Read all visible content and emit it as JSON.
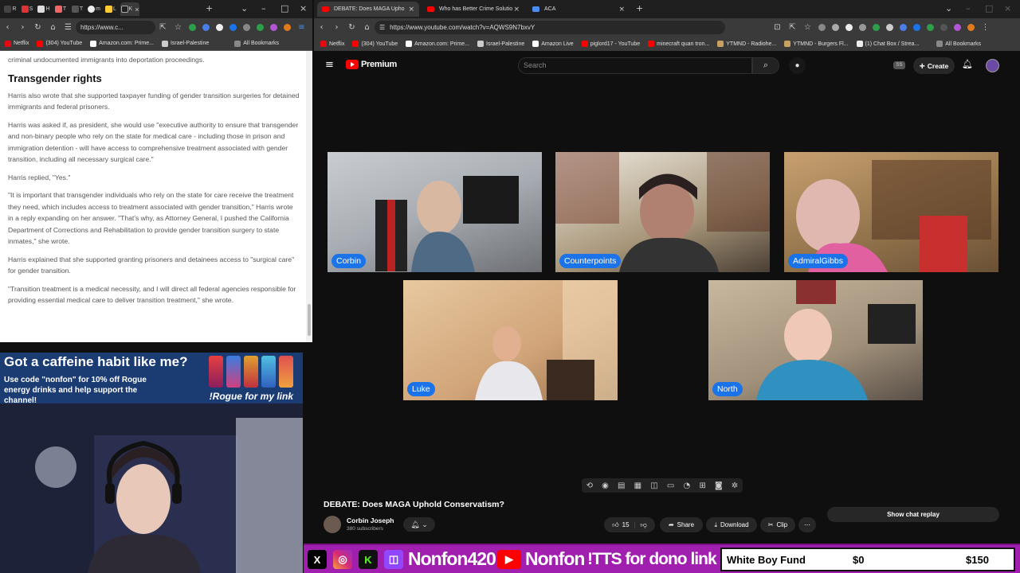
{
  "left_browser": {
    "tabs": [
      "R",
      "S",
      "H",
      "T",
      "T",
      "m",
      "L",
      "K"
    ],
    "url": "https://www.c...",
    "bookmarks": [
      "Netflix",
      "(304) YouTube",
      "Amazon.com: Prime...",
      "Israel-Palestine",
      "All Bookmarks"
    ],
    "article": {
      "lead": "criminal undocumented immigrants into deportation proceedings.",
      "heading": "Transgender rights",
      "paragraphs": [
        "Harris also wrote that she supported taxpayer funding of gender transition surgeries for detained immigrants and federal prisoners.",
        "Harris was asked if, as president, she would use \"executive authority to ensure that transgender and non-binary people who rely on the state for medical care - including those in prison and immigration detention - will have access to comprehensive treatment associated with gender transition, including all necessary surgical care.\"",
        "Harris replied, \"Yes.\"",
        "\"It is important that transgender individuals who rely on the state for care receive the treatment they need, which includes access to treatment associated with gender transition,\" Harris wrote in a reply expanding on her answer. \"That's why, as Attorney General, I pushed the California Department of Corrections and Rehabilitation to provide gender transition surgery to state inmates,\" she wrote.",
        "Harris explained that she supported granting prisoners and detainees access to \"surgical care\" for gender transition.",
        "\"Transition treatment is a medical necessity, and I will direct all federal agencies responsible for providing essential medical care to deliver transition treatment,\" she wrote."
      ]
    }
  },
  "promo": {
    "headline": "Got a caffeine habit like me?",
    "body": "Use code \"nonfon\" for 10% off Rogue energy drinks and help support the channel!",
    "cta": "!Rogue for my link"
  },
  "right_browser": {
    "tabs": [
      {
        "label": "DEBATE: Does MAGA Upho",
        "active": true
      },
      {
        "label": "Who has Better Crime Solutio",
        "active": false
      },
      {
        "label": "ACA",
        "active": false
      }
    ],
    "url": "https://www.youtube.com/watch?v=AQWS9N7bxvY",
    "bookmarks": [
      "Netflix",
      "(304) YouTube",
      "Amazon.com: Prime...",
      "Israel-Palestine",
      "Amazon Live",
      "piglord17 - YouTube",
      "minecraft quan tron...",
      "YTMND - Radiohe...",
      "YTMND - Burgers Fl...",
      "(1) Chat Box / Strea...",
      "All Bookmarks"
    ]
  },
  "youtube": {
    "logo_text": "Premium",
    "search_placeholder": "Search",
    "create_label": "Create",
    "ss_badge": "SS",
    "participants": [
      "Corbin",
      "Counterpoints",
      "AdmiralGibbs",
      "Luke",
      "North"
    ],
    "video_title": "DEBATE: Does MAGA Uphold Conservatism?",
    "channel_name": "Corbin Joseph",
    "subscribers": "380 subscribers",
    "likes": "15",
    "share_label": "Share",
    "download_label": "Download",
    "clip_label": "Clip",
    "chat_replay_label": "Show chat replay"
  },
  "stream_bar": {
    "twitch_name": "Nonfon420",
    "youtube_name": "Nonfon",
    "tts_text": "!TTS for dono link",
    "goal_label": "White Boy Fund",
    "goal_current": "$0",
    "goal_target": "$150"
  },
  "colors": {
    "youtube_red": "#ff0000",
    "name_tag_blue": "#1a73e8",
    "stream_bar_purple": "#a01fae"
  }
}
